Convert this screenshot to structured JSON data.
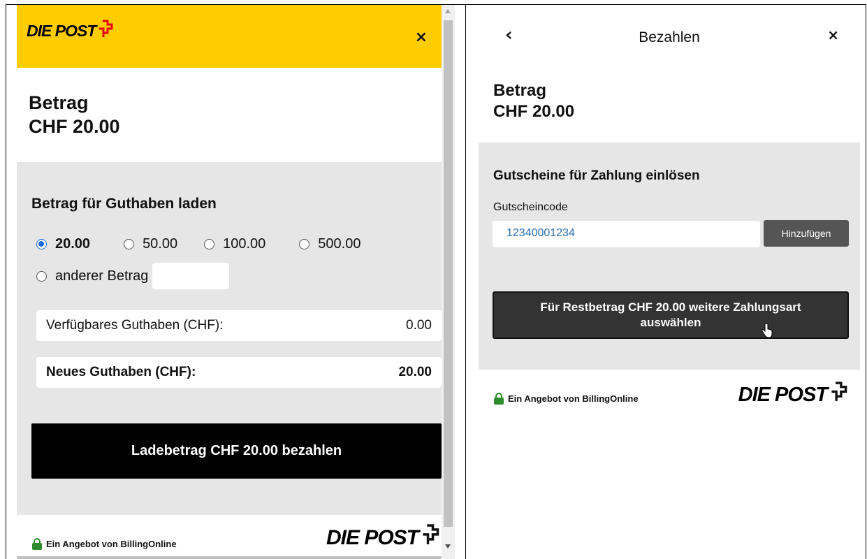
{
  "left": {
    "logo_text": "DIE POST",
    "close_icon": "×",
    "amount_label": "Betrag",
    "amount_value": "CHF 20.00",
    "section_title": "Betrag für Guthaben laden",
    "options": [
      {
        "label": "20.00",
        "checked": true
      },
      {
        "label": "50.00",
        "checked": false
      },
      {
        "label": "100.00",
        "checked": false
      },
      {
        "label": "500.00",
        "checked": false
      }
    ],
    "other_amount_label": "anderer Betrag",
    "other_amount_value": "",
    "available_label": "Verfügbares Guthaben (CHF):",
    "available_value": "0.00",
    "new_label": "Neues Guthaben (CHF):",
    "new_value": "20.00",
    "pay_button": "Ladebetrag CHF 20.00 bezahlen",
    "footer_offer": "Ein Angebot von BillingOnline",
    "footer_logo": "DIE POST"
  },
  "right": {
    "back_icon": "‹",
    "title": "Bezahlen",
    "close_icon": "×",
    "amount_label": "Betrag",
    "amount_value": "CHF 20.00",
    "voucher_title": "Gutscheine für Zahlung einlösen",
    "code_label": "Gutscheincode",
    "code_value": "12340001234",
    "add_button": "Hinzufügen",
    "rest_button": "Für Restbetrag CHF 20.00 weitere Zahlungsart auswählen",
    "footer_offer": "Ein Angebot von BillingOnline",
    "footer_logo": "DIE POST"
  },
  "colors": {
    "brand_yellow": "#ffcc00",
    "brand_red": "#e30613",
    "radio_blue": "#1a6ad9",
    "lock_green": "#2e8b2e",
    "code_blue": "#2b6cb0"
  },
  "icons": {
    "lock": "lock-icon",
    "close": "close-icon",
    "back": "chevron-left-icon",
    "post_cross": "post-cross-icon",
    "cursor": "hand-pointer-icon"
  }
}
